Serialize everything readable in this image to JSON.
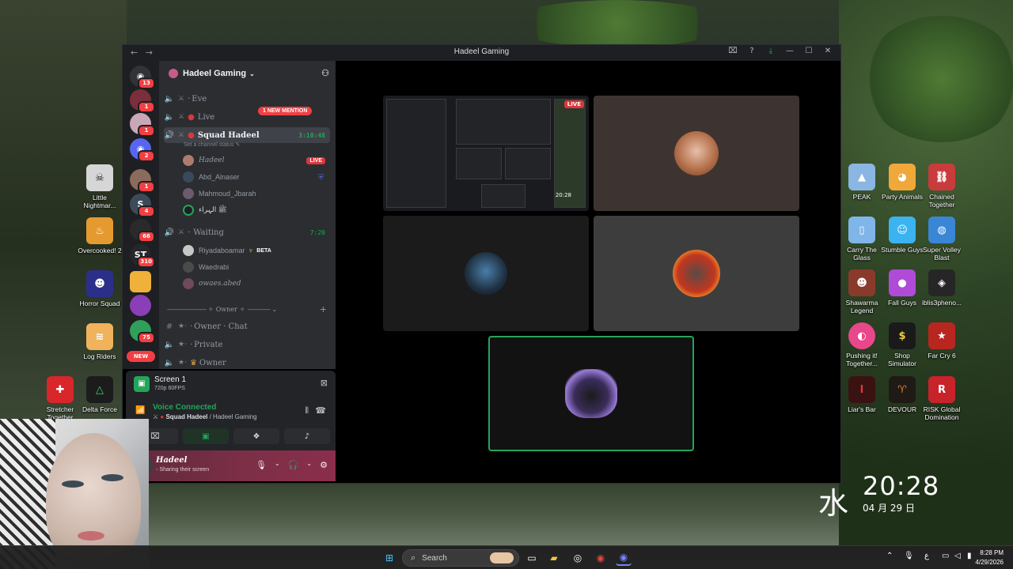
{
  "window": {
    "title": "Hadeel Gaming",
    "nav_back": "←",
    "nav_forward": "→",
    "controls": [
      "⌧",
      "?",
      "⤓",
      "—",
      "☐",
      "✕"
    ]
  },
  "guilds": {
    "badges": [
      "13",
      "1",
      "1",
      "2",
      "1",
      "4",
      "66",
      "310",
      "75"
    ],
    "new_label": "NEW"
  },
  "server": {
    "name": "Hadeel Gaming",
    "mention_pill": "1 NEW MENTION",
    "channels": {
      "events": "Eve",
      "live": "Live",
      "squad": "Squad Hadeel",
      "squad_timer": "3:10:48",
      "squad_status": "Set a channel status",
      "waiting": "Waiting",
      "waiting_timer": "7:20",
      "owner_chat": "Owner · Chat",
      "private": "Private",
      "owner": "Owner"
    },
    "squad_members": [
      {
        "name": "Hadeel",
        "tag": "LIVE"
      },
      {
        "name": "Abd_Alnaser"
      },
      {
        "name": "Mahmoud_Jbarah"
      },
      {
        "name": "ﷺ الہراء"
      }
    ],
    "waiting_members": [
      {
        "name": "Riyadaboamar",
        "tag": "BETA"
      },
      {
        "name": "Waedrabi"
      },
      {
        "name": "owaes.abed"
      }
    ],
    "category": "Owner"
  },
  "screen_share": {
    "name": "Screen 1",
    "quality": "720p 60FPS"
  },
  "voice": {
    "title": "Voice Connected",
    "channel": "Squad Hadeel",
    "server": "Hadeel Gaming"
  },
  "user": {
    "name": "Hadeel",
    "status": "Sharing their screen"
  },
  "stage": {
    "live_label": "LIVE",
    "preview_time": "20:28"
  },
  "desktop_icons_left": [
    {
      "label": "Little Nightmar...",
      "icon": "ghost-icon",
      "color": "#d6d6d6"
    },
    {
      "label": "Overcooked! 2",
      "icon": "chef-icon",
      "color": "#e59a2f"
    },
    {
      "label": "Horror Squad",
      "icon": "mask-icon",
      "color": "#2b2f8a"
    },
    {
      "label": "Log Riders",
      "icon": "log-icon",
      "color": "#f0b35b"
    },
    {
      "label": "Stretcher Together",
      "icon": "cross-icon",
      "color": "#d8262a"
    },
    {
      "label": "Delta Force",
      "icon": "triangle-icon",
      "color": "#1c1c1c"
    }
  ],
  "desktop_icons_right": [
    {
      "label": "PEAK",
      "icon": "mountain-icon",
      "color": "#8bb6e3"
    },
    {
      "label": "Party Animals",
      "icon": "dog-icon",
      "color": "#f0a83b"
    },
    {
      "label": "Chained Together",
      "icon": "chain-icon",
      "color": "#c93c3c"
    },
    {
      "label": "Carry The Glass",
      "icon": "glass-icon",
      "color": "#7fb5e8"
    },
    {
      "label": "Stumble Guys",
      "icon": "runner-icon",
      "color": "#3bb3f0"
    },
    {
      "label": "Super Volley Blast",
      "icon": "volleyball-icon",
      "color": "#3a86d6"
    },
    {
      "label": "Shawarma Legend",
      "icon": "chef-icon",
      "color": "#8a3a2a"
    },
    {
      "label": "Fall Guys",
      "icon": "bean-icon",
      "color": "#b04bd8"
    },
    {
      "label": "iblis3pheno...",
      "icon": "game-icon",
      "color": "#262626"
    },
    {
      "label": "Pushing it! Together...",
      "icon": "ball-icon",
      "color": "#e8478c"
    },
    {
      "label": "Shop Simulator",
      "icon": "dollar-icon",
      "color": "#f0d03a"
    },
    {
      "label": "Far Cry 6",
      "icon": "star-icon",
      "color": "#b8261f"
    },
    {
      "label": "Liar's Bar",
      "icon": "bar-icon",
      "color": "#3a1212"
    },
    {
      "label": "DEVOUR",
      "icon": "goat-icon",
      "color": "#1f1a16"
    },
    {
      "label": "RISK Global Domination",
      "icon": "risk-icon",
      "color": "#c8232a"
    }
  ],
  "clock": {
    "glyph": "水",
    "time": "20:28",
    "date": "04 月 29 日"
  },
  "taskbar": {
    "search_placeholder": "Search",
    "time": "8:28 PM",
    "date": "4/29/2026",
    "lang": "ع"
  }
}
